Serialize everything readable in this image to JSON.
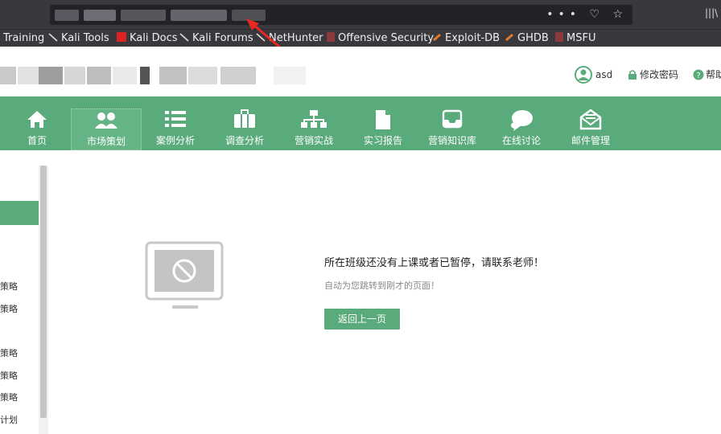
{
  "browser": {
    "url_actions": "••• ♡ ☆",
    "library_icon": "|||\\",
    "bookmarks": [
      {
        "label": "Training",
        "icon": "none"
      },
      {
        "label": "Kali Tools",
        "icon": "kali-dragon-icon"
      },
      {
        "label": "Kali Docs",
        "icon": "kali-docs-icon"
      },
      {
        "label": "Kali Forums",
        "icon": "kali-dragon-icon"
      },
      {
        "label": "NetHunter",
        "icon": "kali-dragon-icon"
      },
      {
        "label": "Offensive Security",
        "icon": "offsec-icon"
      },
      {
        "label": "Exploit-DB",
        "icon": "exploitdb-icon"
      },
      {
        "label": "GHDB",
        "icon": "exploitdb-icon"
      },
      {
        "label": "MSFU",
        "icon": "offsec-icon"
      }
    ]
  },
  "header": {
    "username": "asd",
    "change_password": "修改密码",
    "help": "帮助"
  },
  "nav": {
    "items": [
      {
        "label": "首页",
        "icon": "home-icon"
      },
      {
        "label": "市场策划",
        "icon": "users-icon"
      },
      {
        "label": "案例分析",
        "icon": "list-icon"
      },
      {
        "label": "调查分析",
        "icon": "briefcase-icon"
      },
      {
        "label": "营销实战",
        "icon": "org-chart-icon"
      },
      {
        "label": "实习报告",
        "icon": "document-icon"
      },
      {
        "label": "营销知识库",
        "icon": "inbox-icon"
      },
      {
        "label": "在线讨论",
        "icon": "chat-icon"
      },
      {
        "label": "邮件管理",
        "icon": "mail-icon"
      }
    ]
  },
  "sidebar": {
    "items": [
      "策略",
      "策略",
      "策略",
      "策略",
      "策略",
      "计划"
    ]
  },
  "message": {
    "title": "所在班级还没有上课或者已暂停，请联系老师！",
    "subtitle": "自动为您跳转到刚才的页面！",
    "back_button": "返回上一页"
  },
  "colors": {
    "accent": "#5aab7b",
    "chrome": "#38383d",
    "arrow": "#e8281e"
  }
}
